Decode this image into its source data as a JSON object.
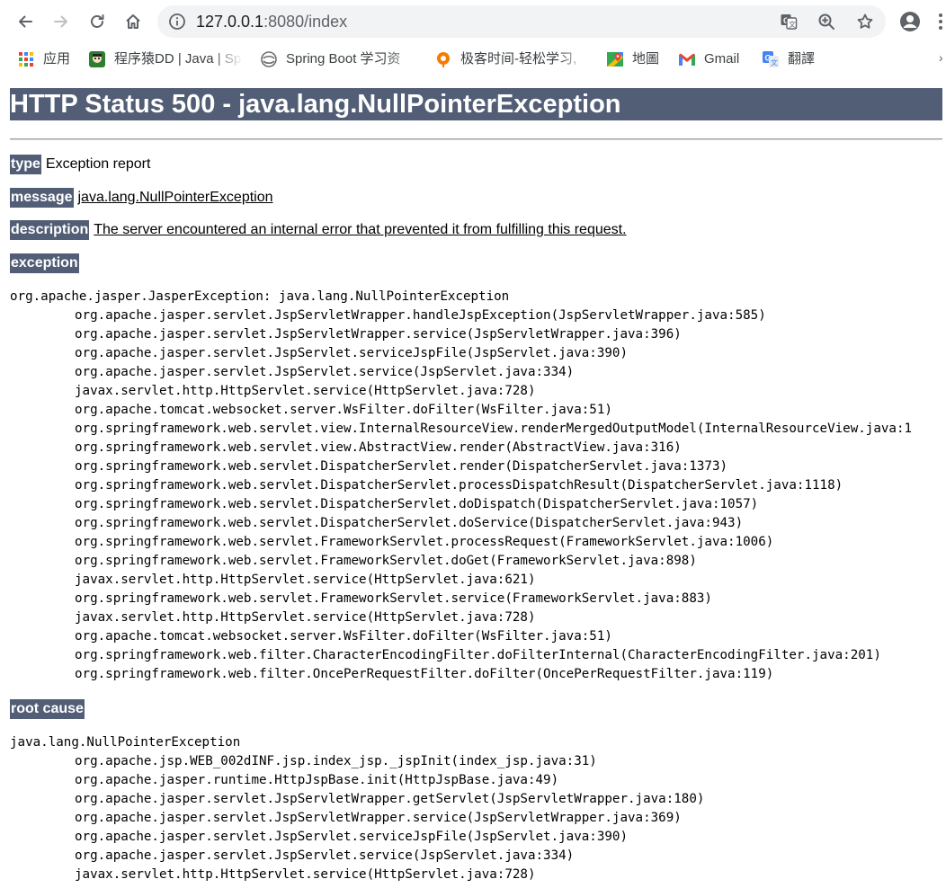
{
  "browser": {
    "url_host": "127.0.0.1",
    "url_rest": ":8080/index",
    "bookmarks": [
      {
        "icon": "apps-grid-icon",
        "label": "应用"
      },
      {
        "icon": "avatar-favicon",
        "label": "程序猿DD | Java | Sp"
      },
      {
        "icon": "spring-favicon",
        "label": "Spring Boot 学习资"
      },
      {
        "icon": "geek-favicon",
        "label": "极客时间-轻松学习,"
      },
      {
        "icon": "maps-favicon",
        "label": "地圖"
      },
      {
        "icon": "gmail-favicon",
        "label": "Gmail"
      },
      {
        "icon": "translate-favicon",
        "label": "翻譯"
      }
    ]
  },
  "page": {
    "title": "HTTP Status 500 - java.lang.NullPointerException",
    "type_label": "type",
    "type_value": "Exception report",
    "message_label": "message",
    "message_value": "java.lang.NullPointerException",
    "description_label": "description",
    "description_value": "The server encountered an internal error that prevented it from fulfilling this request.",
    "exception_label": "exception",
    "exception_trace": [
      "org.apache.jasper.JasperException: java.lang.NullPointerException",
      "org.apache.jasper.servlet.JspServletWrapper.handleJspException(JspServletWrapper.java:585)",
      "org.apache.jasper.servlet.JspServletWrapper.service(JspServletWrapper.java:396)",
      "org.apache.jasper.servlet.JspServlet.serviceJspFile(JspServlet.java:390)",
      "org.apache.jasper.servlet.JspServlet.service(JspServlet.java:334)",
      "javax.servlet.http.HttpServlet.service(HttpServlet.java:728)",
      "org.apache.tomcat.websocket.server.WsFilter.doFilter(WsFilter.java:51)",
      "org.springframework.web.servlet.view.InternalResourceView.renderMergedOutputModel(InternalResourceView.java:1",
      "org.springframework.web.servlet.view.AbstractView.render(AbstractView.java:316)",
      "org.springframework.web.servlet.DispatcherServlet.render(DispatcherServlet.java:1373)",
      "org.springframework.web.servlet.DispatcherServlet.processDispatchResult(DispatcherServlet.java:1118)",
      "org.springframework.web.servlet.DispatcherServlet.doDispatch(DispatcherServlet.java:1057)",
      "org.springframework.web.servlet.DispatcherServlet.doService(DispatcherServlet.java:943)",
      "org.springframework.web.servlet.FrameworkServlet.processRequest(FrameworkServlet.java:1006)",
      "org.springframework.web.servlet.FrameworkServlet.doGet(FrameworkServlet.java:898)",
      "javax.servlet.http.HttpServlet.service(HttpServlet.java:621)",
      "org.springframework.web.servlet.FrameworkServlet.service(FrameworkServlet.java:883)",
      "javax.servlet.http.HttpServlet.service(HttpServlet.java:728)",
      "org.apache.tomcat.websocket.server.WsFilter.doFilter(WsFilter.java:51)",
      "org.springframework.web.filter.CharacterEncodingFilter.doFilterInternal(CharacterEncodingFilter.java:201)",
      "org.springframework.web.filter.OncePerRequestFilter.doFilter(OncePerRequestFilter.java:119)"
    ],
    "root_cause_label": "root cause",
    "root_cause_trace": [
      "java.lang.NullPointerException",
      "org.apache.jsp.WEB_002dINF.jsp.index_jsp._jspInit(index_jsp.java:31)",
      "org.apache.jasper.runtime.HttpJspBase.init(HttpJspBase.java:49)",
      "org.apache.jasper.servlet.JspServletWrapper.getServlet(JspServletWrapper.java:180)",
      "org.apache.jasper.servlet.JspServletWrapper.service(JspServletWrapper.java:369)",
      "org.apache.jasper.servlet.JspServlet.serviceJspFile(JspServlet.java:390)",
      "org.apache.jasper.servlet.JspServlet.service(JspServlet.java:334)",
      "javax.servlet.http.HttpServlet.service(HttpServlet.java:728)"
    ]
  },
  "colors": {
    "header_bg": "#525d76",
    "omnibox_bg": "#f1f3f4"
  }
}
